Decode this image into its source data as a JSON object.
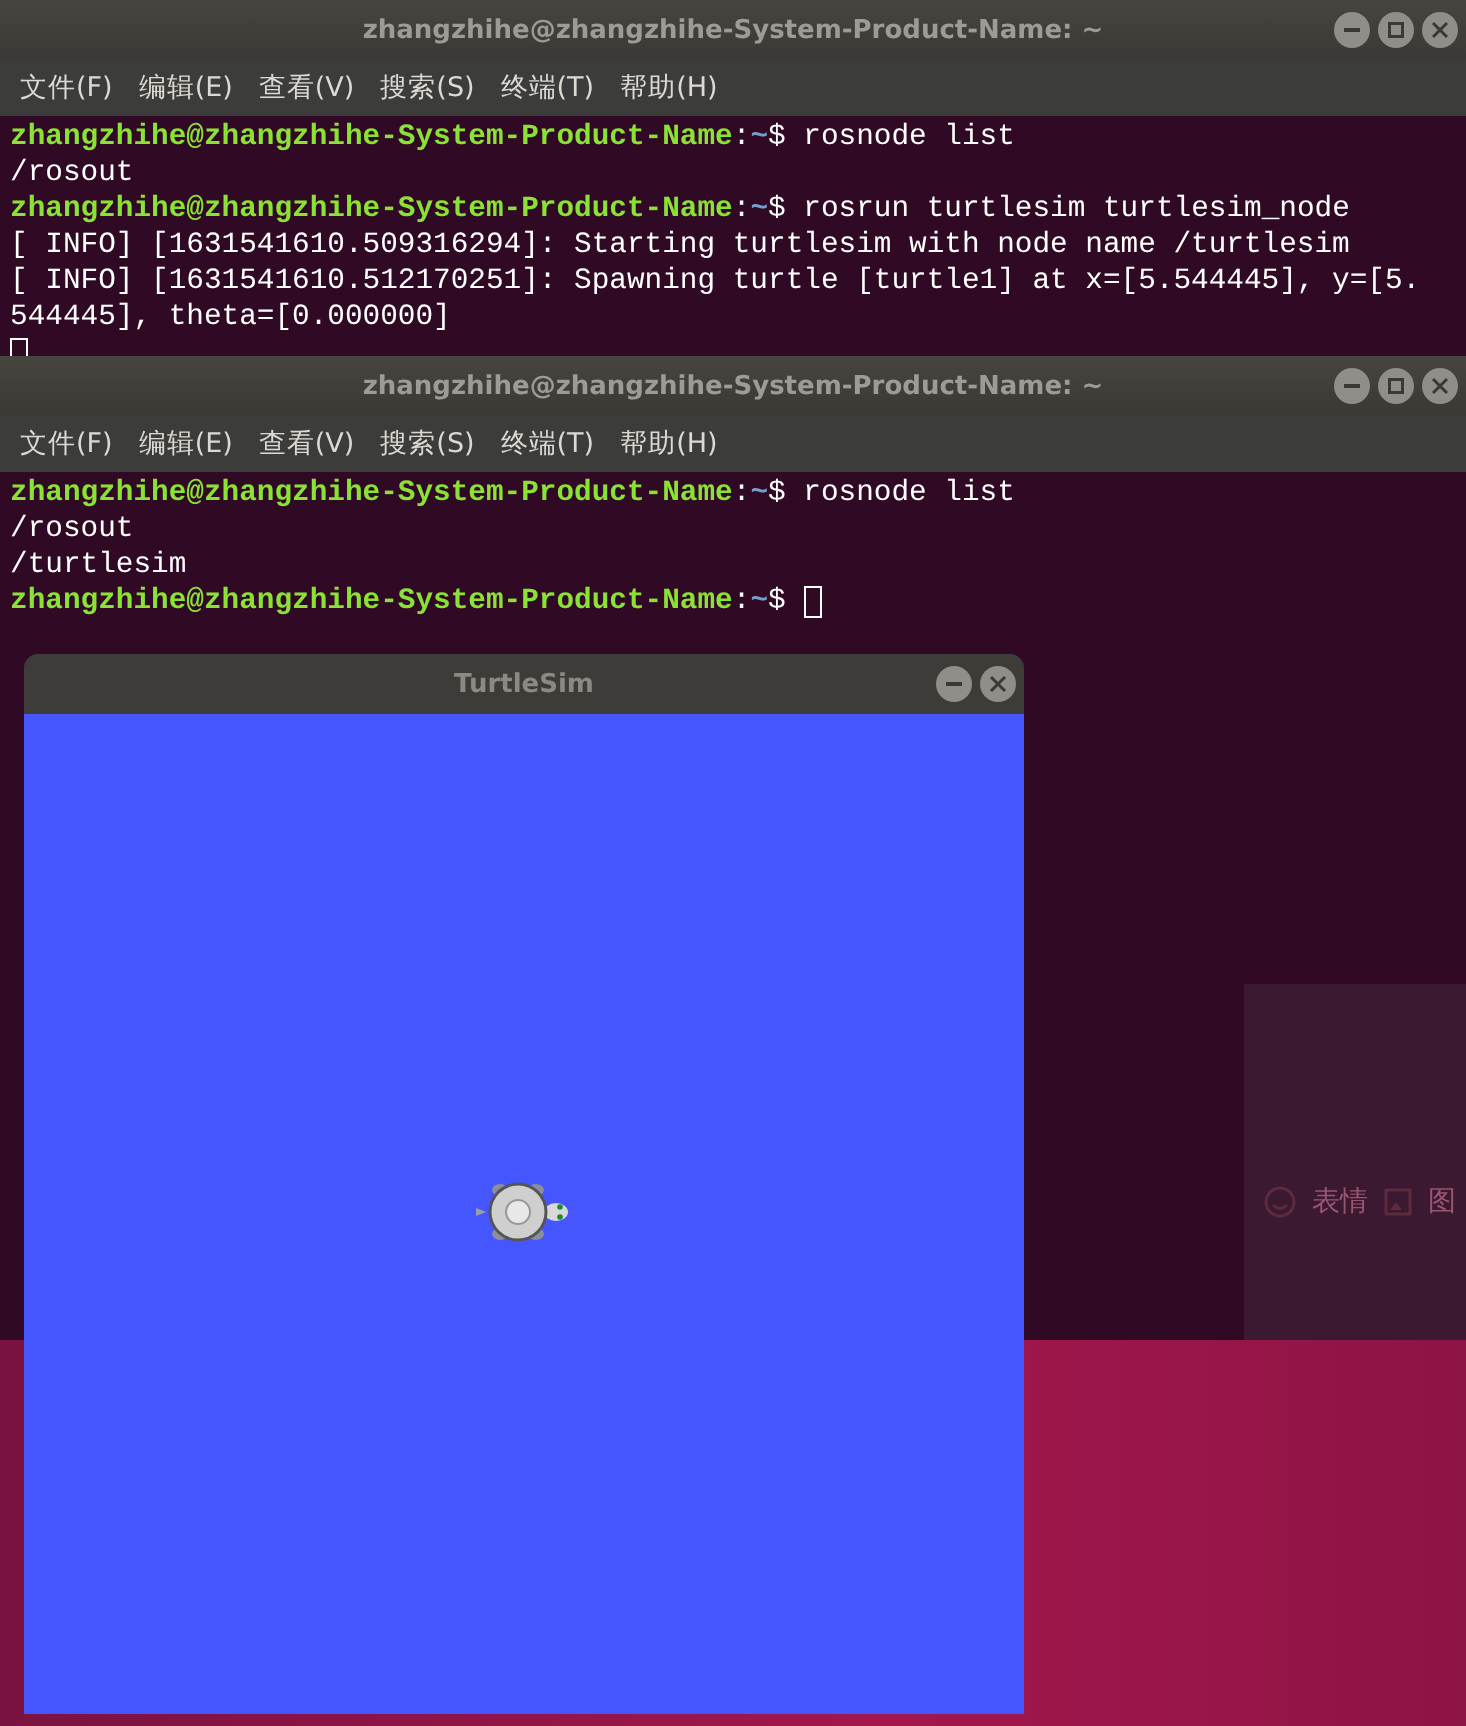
{
  "terminals": [
    {
      "title": "zhangzhihe@zhangzhihe-System-Product-Name: ~",
      "controls": [
        {
          "kind": "minimize"
        },
        {
          "kind": "maximize"
        },
        {
          "kind": "close"
        }
      ],
      "menu": [
        "文件(F)",
        "编辑(E)",
        "查看(V)",
        "搜索(S)",
        "终端(T)",
        "帮助(H)"
      ],
      "lines": [
        {
          "kind": "prompt",
          "user_host": "zhangzhihe@zhangzhihe-System-Product-Name",
          "separator": ":",
          "path": "~",
          "command": "$ rosnode list",
          "cursor": false
        },
        {
          "kind": "output",
          "text": "/rosout"
        },
        {
          "kind": "prompt",
          "user_host": "zhangzhihe@zhangzhihe-System-Product-Name",
          "separator": ":",
          "path": "~",
          "command": "$ rosrun turtlesim turtlesim_node",
          "cursor": false
        },
        {
          "kind": "output",
          "text": "[ INFO] [1631541610.509316294]: Starting turtlesim with node name /turtlesim"
        },
        {
          "kind": "output",
          "text": "[ INFO] [1631541610.512170251]: Spawning turtle [turtle1] at x=[5.544445], y=[5."
        },
        {
          "kind": "output",
          "text": "544445], theta=[0.000000]"
        },
        {
          "kind": "cursor"
        }
      ]
    },
    {
      "title": "zhangzhihe@zhangzhihe-System-Product-Name: ~",
      "controls": [
        {
          "kind": "minimize"
        },
        {
          "kind": "maximize"
        },
        {
          "kind": "close"
        }
      ],
      "menu": [
        "文件(F)",
        "编辑(E)",
        "查看(V)",
        "搜索(S)",
        "终端(T)",
        "帮助(H)"
      ],
      "lines": [
        {
          "kind": "prompt",
          "user_host": "zhangzhihe@zhangzhihe-System-Product-Name",
          "separator": ":",
          "path": "~",
          "command": "$ rosnode list",
          "cursor": false
        },
        {
          "kind": "output",
          "text": "/rosout"
        },
        {
          "kind": "output",
          "text": "/turtlesim"
        },
        {
          "kind": "prompt",
          "user_host": "zhangzhihe@zhangzhihe-System-Product-Name",
          "separator": ":",
          "path": "~",
          "command": "$",
          "cursor": true
        }
      ]
    }
  ],
  "background_window": {
    "toolbar": [
      "表情",
      "图"
    ]
  },
  "turtlesim": {
    "title": "TurtleSim",
    "controls": [
      {
        "kind": "minimize"
      },
      {
        "kind": "close"
      }
    ]
  }
}
